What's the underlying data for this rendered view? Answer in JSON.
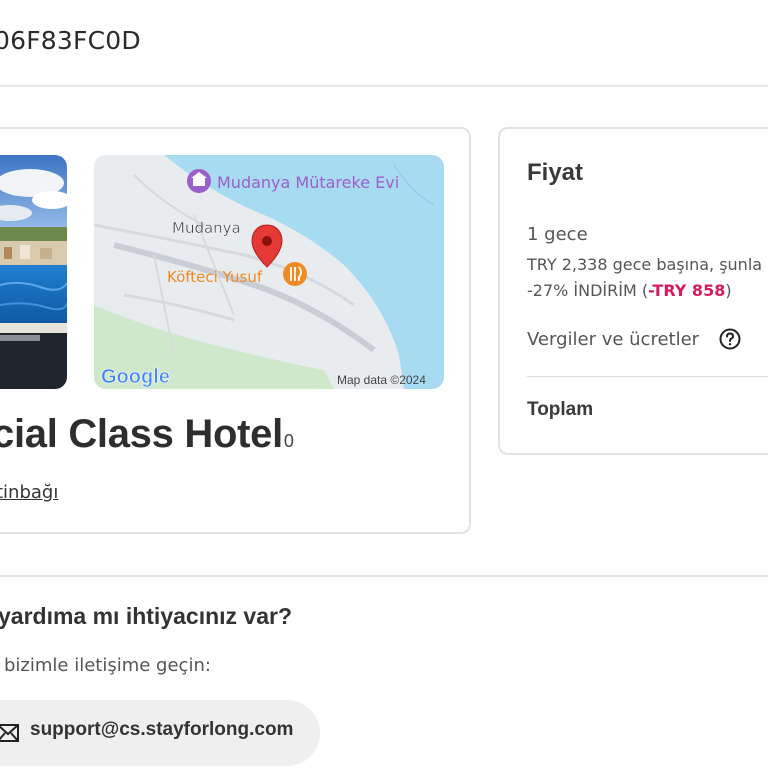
{
  "booking": {
    "reference": "06F83FC0D"
  },
  "hotel": {
    "name": "cial Class Hotel",
    "stars": "0",
    "location": "tinbağı"
  },
  "map": {
    "labels": {
      "poi_top": "Mudanya Mütareke Evi",
      "town": "Mudanya",
      "restaurant": "Köfteci Yusuf",
      "provider": "Google",
      "attribution": "Map data ©2024"
    },
    "colors": {
      "water": "#a7dbf2",
      "land": "#e9ecef",
      "green": "#cfe8cc",
      "poi": "#9c5fc9",
      "restaurant": "#f08a24",
      "pin": "#e53935"
    }
  },
  "price": {
    "title": "Fiyat",
    "nights": "1 gece",
    "per_night": "TRY 2,338 gece başına, şunla",
    "discount_prefix": "-27% İNDİRİM (",
    "discount_amount": "-TRY 858",
    "discount_suffix": ")",
    "taxes_label": "Vergiler ve ücretler",
    "taxes_icon": "question-circle-icon",
    "total_label": "Toplam",
    "discount_color": "#d81b60"
  },
  "help": {
    "heading": "yardıma mı ihtiyacınız var?",
    "contact_text": "bizimle iletişime geçin:",
    "email_icon": "mail-icon",
    "email": "support@cs.stayforlong.com"
  }
}
